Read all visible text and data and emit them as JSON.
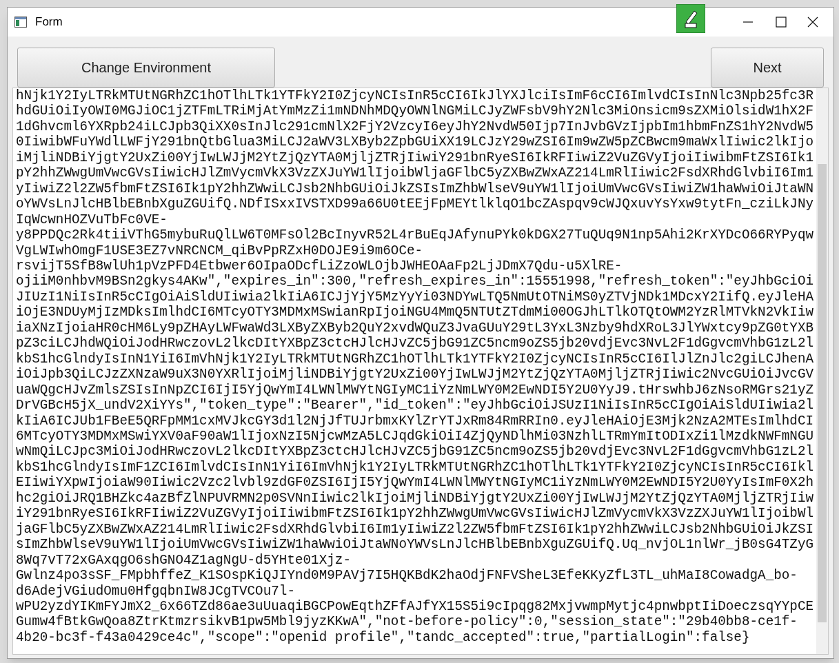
{
  "window": {
    "title": "Form"
  },
  "buttons": [
    {
      "label": "Change Environment"
    },
    {
      "label": "Next"
    }
  ],
  "response_text": {
    "lines": [
      "hNjk1Y2IyLTRkMTUtNGRhZC1hOTlhLTk1YTFkY2I0ZjcyNCIsInR5cCI6IkJlYXJlciIsImF6cCI6ImlvdCIsInNlc3Npb25fc3R",
      "hdGUiOiIyOWI0MGJiOC1jZTFmLTRiMjAtYmMzZi1mNDNhMDQyOWNlNGMiLCJyZWFsbV9hY2Nlc3MiOnsicm9sZXMiOlsidW1hX2F",
      "1dGhvcml6YXRpb24iLCJpb3QiXX0sInJlc291cmNlX2FjY2VzcyI6eyJhY2NvdW50Ijp7InJvbGVzIjpbIm1hbmFnZS1hY2NvdW5",
      "0IiwibWFuYWdlLWFjY291bnQtbGlua3MiLCJ2aWV3LXByb2ZpbGUiXX19LCJzY29wZSI6Im9wZW5pZCBwcm9maWxlIiwic2lkIjo",
      "iMjliNDBiYjgtY2UxZi00YjIwLWJjM2YtZjQzYTA0MjljZTRjIiwiY291bnRyeSI6IkRFIiwiZ2VuZGVyIjoiIiwibmFtZSI6Ik1",
      "pY2hhZWwgUmVwcGVsIiwicHJlZmVycmVkX3VzZXJuYW1lIjoibWljaGFlbC5yZXBwZWxAZ214LmRlIiwic2FsdXRhdGlvbiI6Im1",
      "yIiwiZ2l2ZW5fbmFtZSI6Ik1pY2hhZWwiLCJsb2NhbGUiOiJkZSIsImZhbWlseV9uYW1lIjoiUmVwcGVsIiwiZW1haWwiOiJtaWN",
      "oYWVsLnJlcHBlbEBnbXguZGUifQ.NDfISxxIVSTXD99a66U0tEEjFpMEYtlklqO1bcZAspqv9cWJQxuvYsYxw9tytFn_cziLkJNy",
      "IqWcwnHOZVuTbFc0VE-",
      "y8PPDQc2Rk4tiiVThG5mybuRuQlLW6T0MFsOl2BcInyvR52L4rBuEqJAfynuPYk0kDGX27TuQUq9N1np5Ahi2KrXYDcO66RYPyqw",
      "VgLWIwhOmgF1USE3EZ7vNRCNCM_qiBvPpRZxH0DOJE9i9m6OCe-",
      "rsvijT5SfB8wlUh1pVzPFD4Etbwer6OIpaODcfLiZzoWLOjbJWHEOAaFp2LjJDmX7Qdu-u5XlRE-",
      "ojiiM0nhbvM9BSn2gkys4AKw\",\"expires_in\":300,\"refresh_expires_in\":15551998,\"refresh_token\":\"eyJhbGciOi",
      "JIUzI1NiIsInR5cCIgOiAiSldUIiwia2lkIiA6ICJjYjY5MzYyYi03NDYwLTQ5NmUtOTNiMS0yZTVjNDk1MDcxY2IifQ.eyJleHA",
      "iOjE3NDUyMjIzMDksImlhdCI6MTcyOTY3MDMxMSwianRpIjoiNGU4MmQ5NTUtZTdmMi00OGJhLTlkOTQtOWM2YzRlMTVkN2VkIiw",
      "iaXNzIjoiaHR0cHM6Ly9pZHAyLWFwaWd3LXByZXByb2QuY2xvdWQuZ3JvaGUuY29tL3YxL3Nzby9hdXRoL3JlYWxtcy9pZG0tYXB",
      "pZ3ciLCJhdWQiOiJodHRwczovL2lkcDItYXBpZ3ctcHJlcHJvZC5jbG91ZC5ncm9oZS5jb20vdjEvc3NvL2F1dGgvcmVhbG1zL2l",
      "kbS1hcGlndyIsInN1YiI6ImVhNjk1Y2IyLTRkMTUtNGRhZC1hOTlhLTk1YTFkY2I0ZjcyNCIsInR5cCI6IlJlZnJlc2giLCJhenA",
      "iOiJpb3QiLCJzZXNzaW9uX3N0YXRlIjoiMjliNDBiYjgtY2UxZi00YjIwLWJjM2YtZjQzYTA0MjljZTRjIiwic2NvcGUiOiJvcGV",
      "uaWQgcHJvZmlsZSIsInNpZCI6IjI5YjQwYmI4LWNlMWYtNGIyMC1iYzNmLWY0M2EwNDI5Y2U0YyJ9.tHrswhbJ6zNsoRMGrs21yZ",
      "DrVGBcH5jX_undV2XiYYs\",\"token_type\":\"Bearer\",\"id_token\":\"eyJhbGciOiJSUzI1NiIsInR5cCIgOiAiSldUIiwia2l",
      "kIiA6ICJUb1FBeE5QRFpMM1cxMVJkcGY3d1l2NjJfTUJrbmxKYlZrYTJxRm84RmRRIn0.eyJleHAiOjE3Mjk2NzA2MTEsImlhdCI",
      "6MTcyOTY3MDMxMSwiYXV0aF90aW1lIjoxNzI5NjcwMzA5LCJqdGkiOiI4ZjQyNDlhMi03NzhlLTRmYmItODIxZi1lMzdkNWFmNGU",
      "wNmQiLCJpc3MiOiJodHRwczovL2lkcDItYXBpZ3ctcHJlcHJvZC5jbG91ZC5ncm9oZS5jb20vdjEvc3NvL2F1dGgvcmVhbG1zL2l",
      "kbS1hcGlndyIsImF1ZCI6ImlvdCIsInN1YiI6ImVhNjk1Y2IyLTRkMTUtNGRhZC1hOTlhLTk1YTFkY2I0ZjcyNCIsInR5cCI6Ikl",
      "EIiwiYXpwIjoiaW90Iiwic2Vzc2lvbl9zdGF0ZSI6IjI5YjQwYmI4LWNlMWYtNGIyMC1iYzNmLWY0M2EwNDI5Y2U0YyIsImF0X2h",
      "hc2giOiJRQ1BHZkc4azBfZlNPUVRMN2p0SVNnIiwic2lkIjoiMjliNDBiYjgtY2UxZi00YjIwLWJjM2YtZjQzYTA0MjljZTRjIiw",
      "iY291bnRyeSI6IkRFIiwiZ2VuZGVyIjoiIiwibmFtZSI6Ik1pY2hhZWwgUmVwcGVsIiwicHJlZmVycmVkX3VzZXJuYW1lIjoibWl",
      "jaGFlbC5yZXBwZWxAZ214LmRlIiwic2FsdXRhdGlvbiI6Im1yIiwiZ2l2ZW5fbmFtZSI6Ik1pY2hhZWwiLCJsb2NhbGUiOiJkZSI",
      "sImZhbWlseV9uYW1lIjoiUmVwcGVsIiwiZW1haWwiOiJtaWNoYWVsLnJlcHBlbEBnbXguZGUifQ.Uq_nvjOL1nlWr_jB0sG4TZyG",
      "8Wq7vT72xGAxqgO6shGNO4Z1agNgU-d5YHte01Xjz-",
      "Gwlnz4po3sSF_FMpbhffeZ_K1SOspKiQJIYnd0M9PAVj7I5HQKBdK2haOdjFNFVSheL3EfeKKyZfL3TL_uhMaI8CowadgA_bo-",
      "d6AdejVGiudOmu0HfgqbnIW8JCgTVCOu7l-",
      "wPU2yzdYIKmFYJmX2_6x66TZd86ae3uUuaqiBGCPowEqthZFfAJfYX15S5i9cIpqg82MxjvwmpMytjc4pnwbptIiDoeczsqYYpCE",
      "Gumw4fBtkGwQoa8ZtrKtmzrsikvB1pw5Mbl9jyzKKwA\",\"not-before-policy\":0,\"session_state\":\"29b40bb8-ce1f-",
      "4b20-bc3f-f43a0429ce4c\",\"scope\":\"openid profile\",\"tandc_accepted\":true,\"partialLogin\":false}"
    ]
  }
}
